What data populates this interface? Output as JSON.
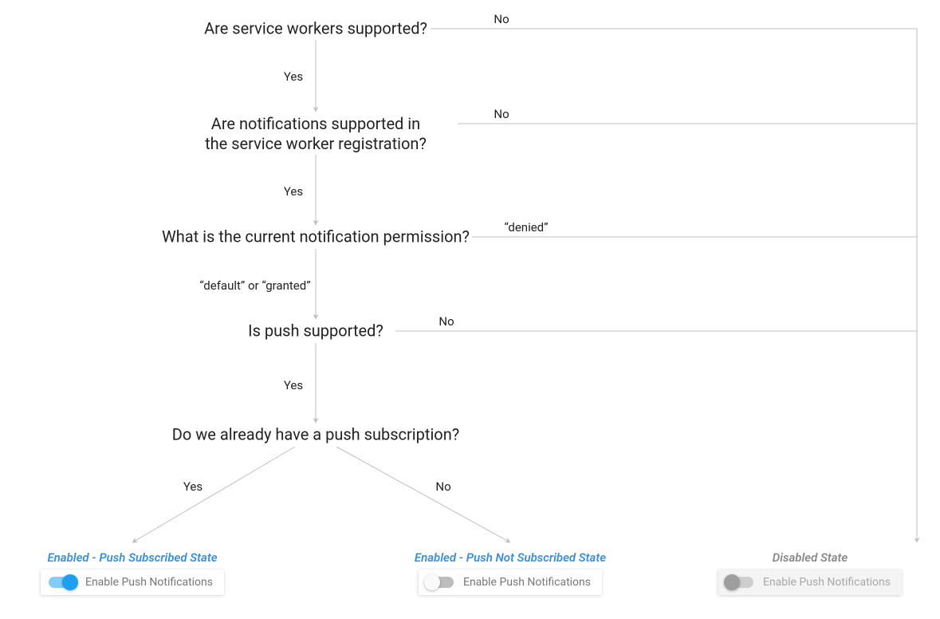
{
  "nodes": {
    "q1": "Are service workers supported?",
    "q2": "Are notifications supported in\nthe service worker registration?",
    "q3": "What is the current notification permission?",
    "q4": "Is push supported?",
    "q5": "Do we already have a push subscription?"
  },
  "edges": {
    "q1_no": "No",
    "q1_yes": "Yes",
    "q2_no": "No",
    "q2_yes": "Yes",
    "q3_denied": "“denied”",
    "q3_default": "“default” or “granted”",
    "q4_no": "No",
    "q4_yes": "Yes",
    "q5_yes": "Yes",
    "q5_no": "No"
  },
  "states": {
    "enabled_sub": {
      "title": "Enabled - Push Subscribed State",
      "toggle_label": "Enable Push Notifications"
    },
    "enabled_unsub": {
      "title": "Enabled - Push Not Subscribed State",
      "toggle_label": "Enable Push Notifications"
    },
    "disabled": {
      "title": "Disabled State",
      "toggle_label": "Enable Push Notifications"
    }
  },
  "colors": {
    "line": "#bfbfbf",
    "accent_blue": "#1e9ff0",
    "title_blue": "#3a8fd6",
    "title_gray": "#8a8a8a"
  }
}
